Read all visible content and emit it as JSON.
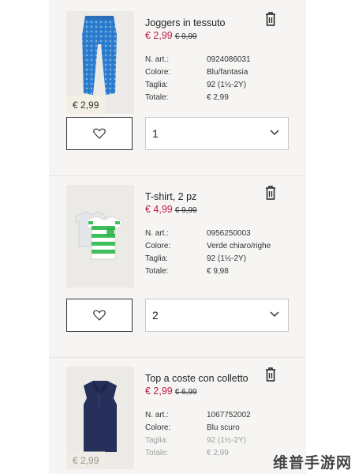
{
  "items": [
    {
      "name": "Joggers in tessuto",
      "price": "€ 2,99",
      "old_price": "€ 9,99",
      "thumb_price": "€ 2,99",
      "details": [
        {
          "label": "N. art.:",
          "value": "0924086031"
        },
        {
          "label": "Colore:",
          "value": "Blu/fantasia"
        },
        {
          "label": "Taglia:",
          "value": "92 (1½-2Y)"
        },
        {
          "label": "Totale:",
          "value": "€ 2,99"
        }
      ],
      "quantity": "1"
    },
    {
      "name": "T-shirt, 2 pz",
      "price": "€ 4,99",
      "old_price": "€ 9,99",
      "details": [
        {
          "label": "N. art.:",
          "value": "0956250003"
        },
        {
          "label": "Colore:",
          "value": "Verde chiaro/righe"
        },
        {
          "label": "Taglia:",
          "value": "92 (1½-2Y)"
        },
        {
          "label": "Totale:",
          "value": "€ 9,98"
        }
      ],
      "quantity": "2"
    },
    {
      "name": "Top a coste con colletto",
      "price": "€ 2,99",
      "old_price": "€ 6,99",
      "thumb_price": "€ 2,99",
      "details": [
        {
          "label": "N. art.:",
          "value": "1067752002"
        },
        {
          "label": "Colore:",
          "value": "Blu scuro"
        },
        {
          "label": "Taglia:",
          "value": "92 (1½-2Y)"
        },
        {
          "label": "Totale:",
          "value": "€ 2,99"
        }
      ]
    }
  ],
  "icons": {
    "delete": "trash-icon",
    "favorite": "heart-icon",
    "dropdown": "chevron-down-icon"
  },
  "colors": {
    "sale_price": "#c0194a",
    "panel_bg": "#f6f5f3"
  },
  "watermark": "维普手游网"
}
